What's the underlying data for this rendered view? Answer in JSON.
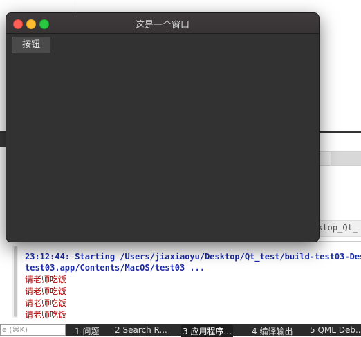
{
  "window": {
    "title": "这是一个窗口",
    "button_label": "按钮"
  },
  "background": {
    "right_truncated_text": "sktop_Qt_"
  },
  "output": {
    "lines": [
      "23:12:44: Starting /Users/jiaxiaoyu/Desktop/Qt_test/build-test03-Des",
      "test03.app/Contents/MacOS/test03 ...",
      "请老师吃饭",
      "请老师吃饭",
      "请老师吃饭",
      "请老师吃饭"
    ]
  },
  "statusbar": {
    "locator_placeholder": "e (⌘K)",
    "tabs": [
      "1  问题",
      "2  Search R...",
      "3  应用程序...",
      "4  编译输出",
      "5  QML Deb..."
    ],
    "active_tab_index": 2
  },
  "colors": {
    "window_bg": "#323232",
    "log_blue": "#1a2aa8",
    "log_red": "#b00000"
  }
}
